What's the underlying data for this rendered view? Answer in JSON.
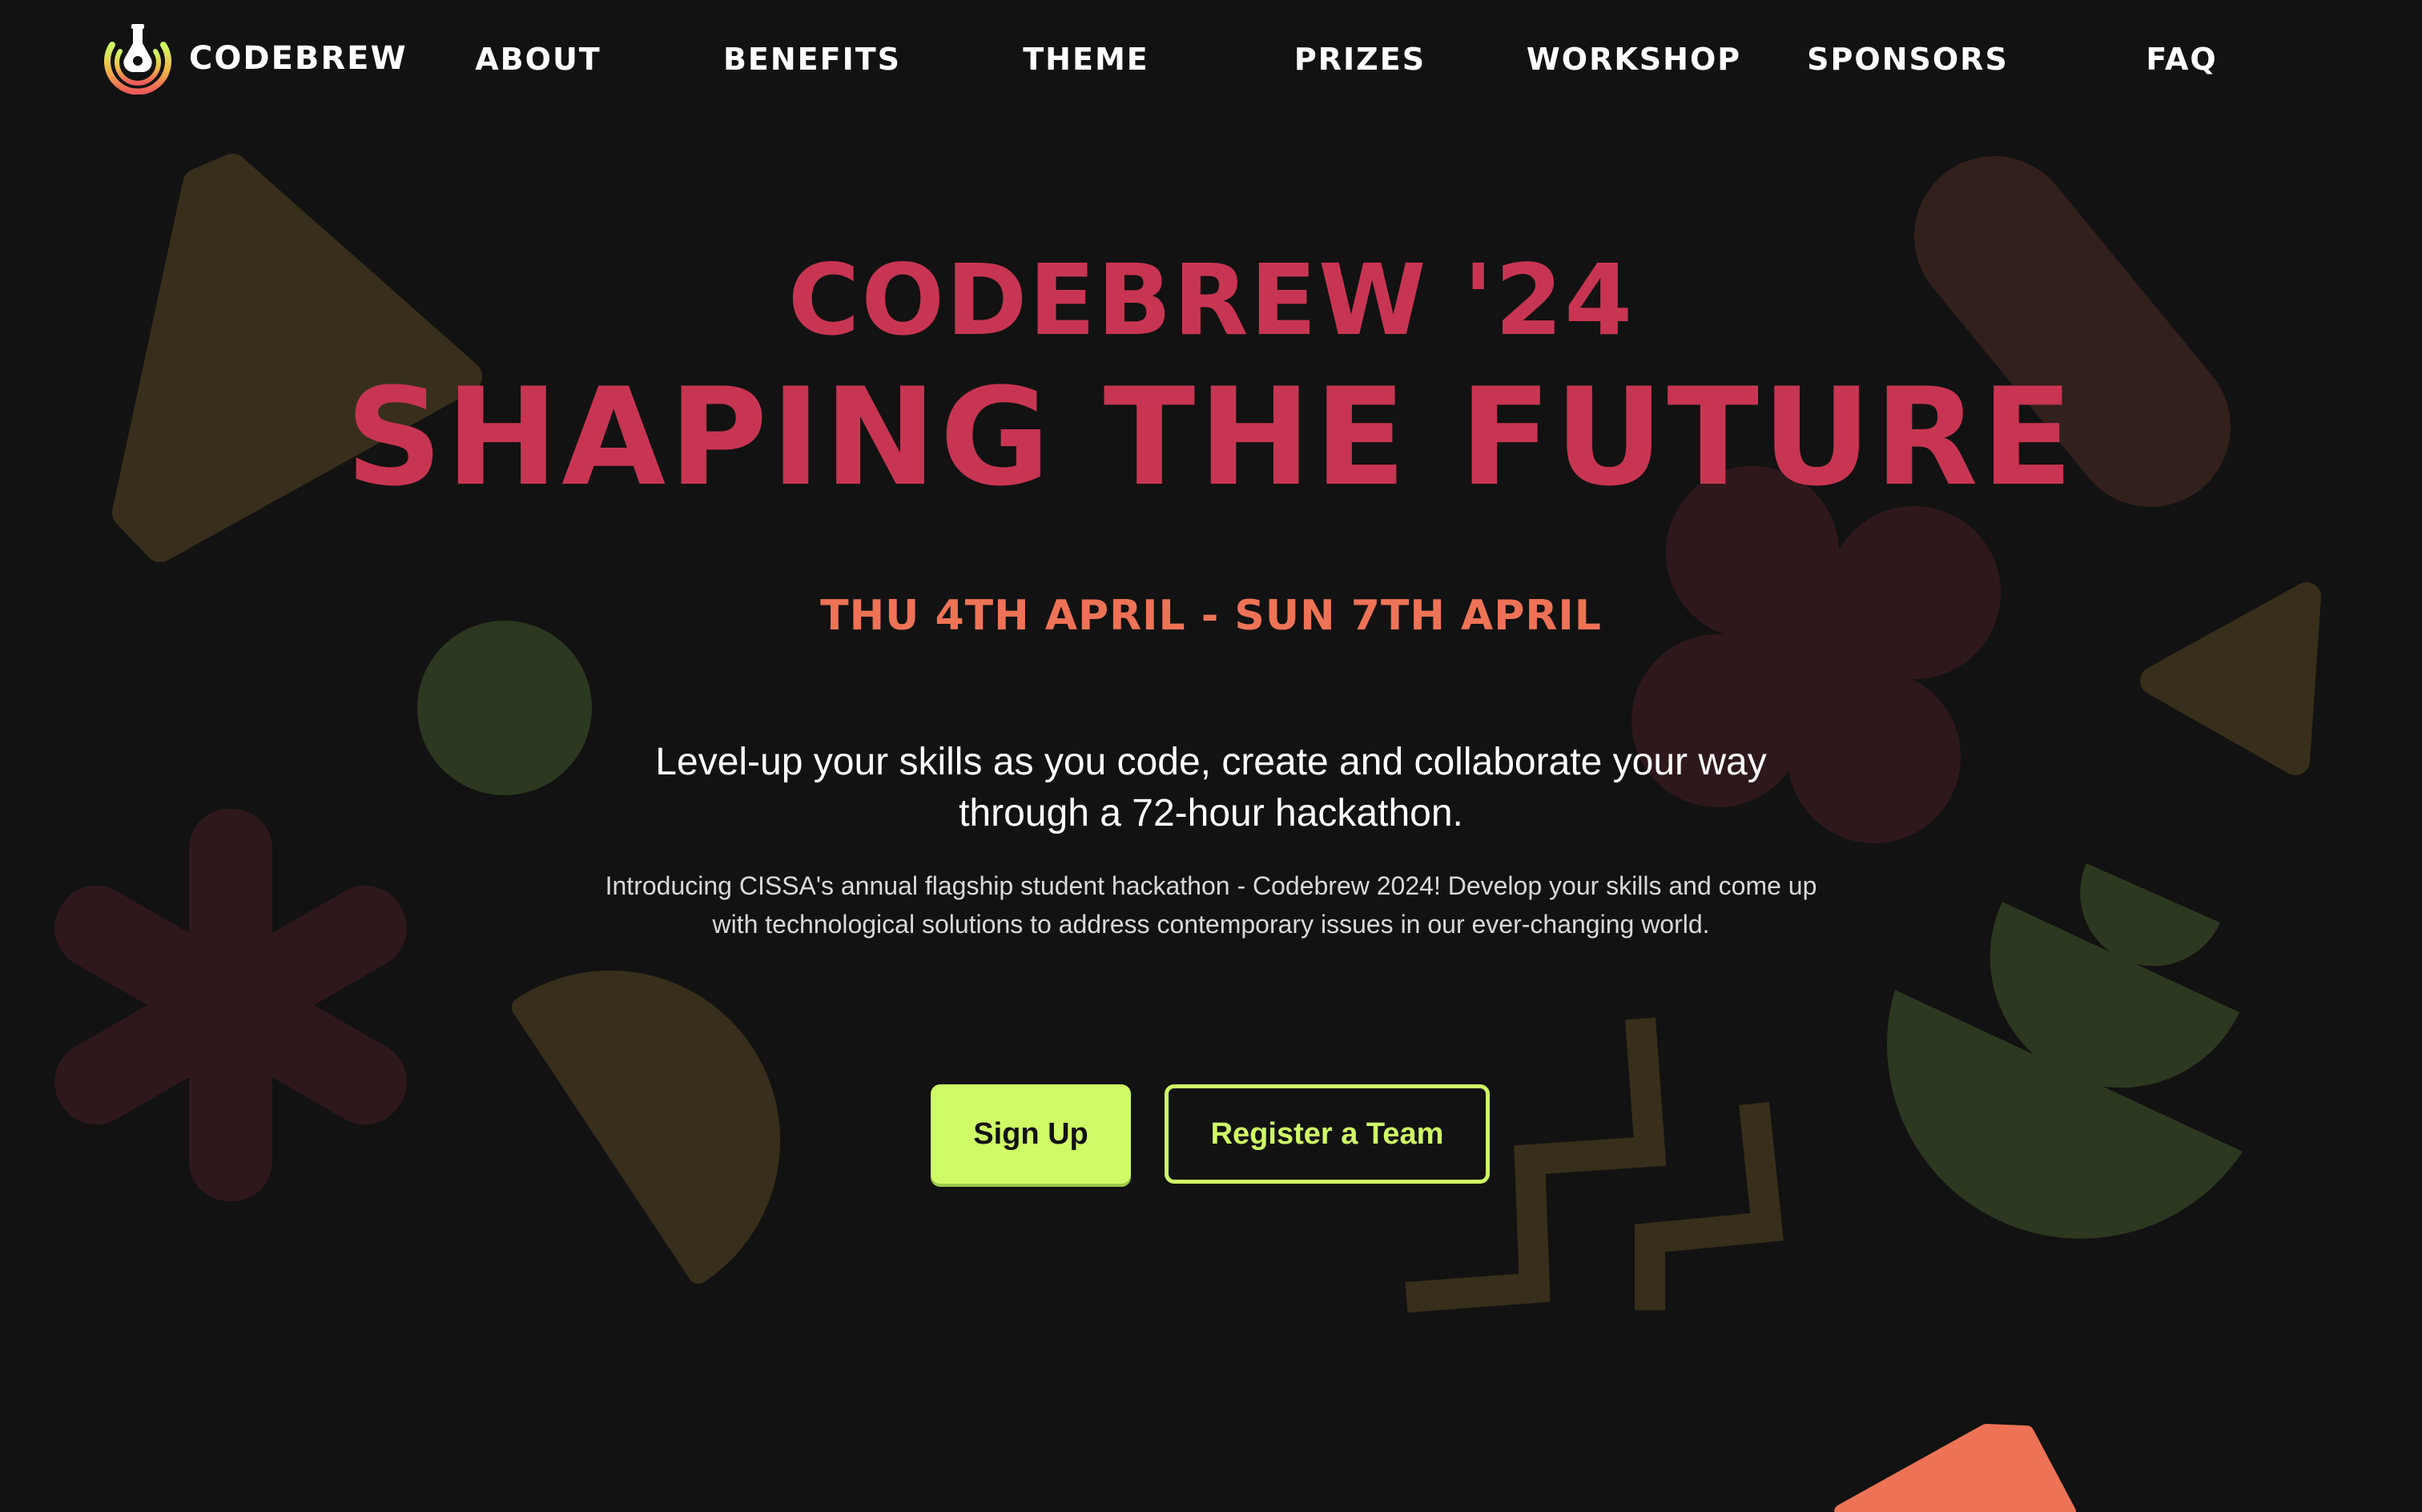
{
  "brand": {
    "name": "CODEBREW",
    "logo_icon": "flask-ring-icon"
  },
  "nav": {
    "items": [
      {
        "label": "ABOUT"
      },
      {
        "label": "BENEFITS"
      },
      {
        "label": "THEME"
      },
      {
        "label": "PRIZES"
      },
      {
        "label": "WORKSHOP"
      },
      {
        "label": "SPONSORS"
      },
      {
        "label": "FAQ"
      }
    ]
  },
  "hero": {
    "subtitle": "CODEBREW '24",
    "title": "SHAPING THE FUTURE",
    "dates": "THU 4TH APRIL - SUN 7TH APRIL",
    "tagline": "Level-up your skills as you code, create and collaborate your way through a 72-hour hackathon.",
    "description": "Introducing CISSA's annual flagship student hackathon - Codebrew 2024! Develop your skills and come up with technological solutions to address contemporary issues in our ever-changing world.",
    "primary_button": "Sign Up",
    "secondary_button": "Register a Team"
  },
  "colors": {
    "background": "#121212",
    "title": "#c83553",
    "dates": "#ee7356",
    "accent_green": "#cffc66",
    "shape_olive": "#372f1b",
    "shape_maroon": "#2f181c",
    "shape_green": "#2d3820",
    "shape_brown": "#32201c",
    "shape_orange": "#ee7356"
  }
}
